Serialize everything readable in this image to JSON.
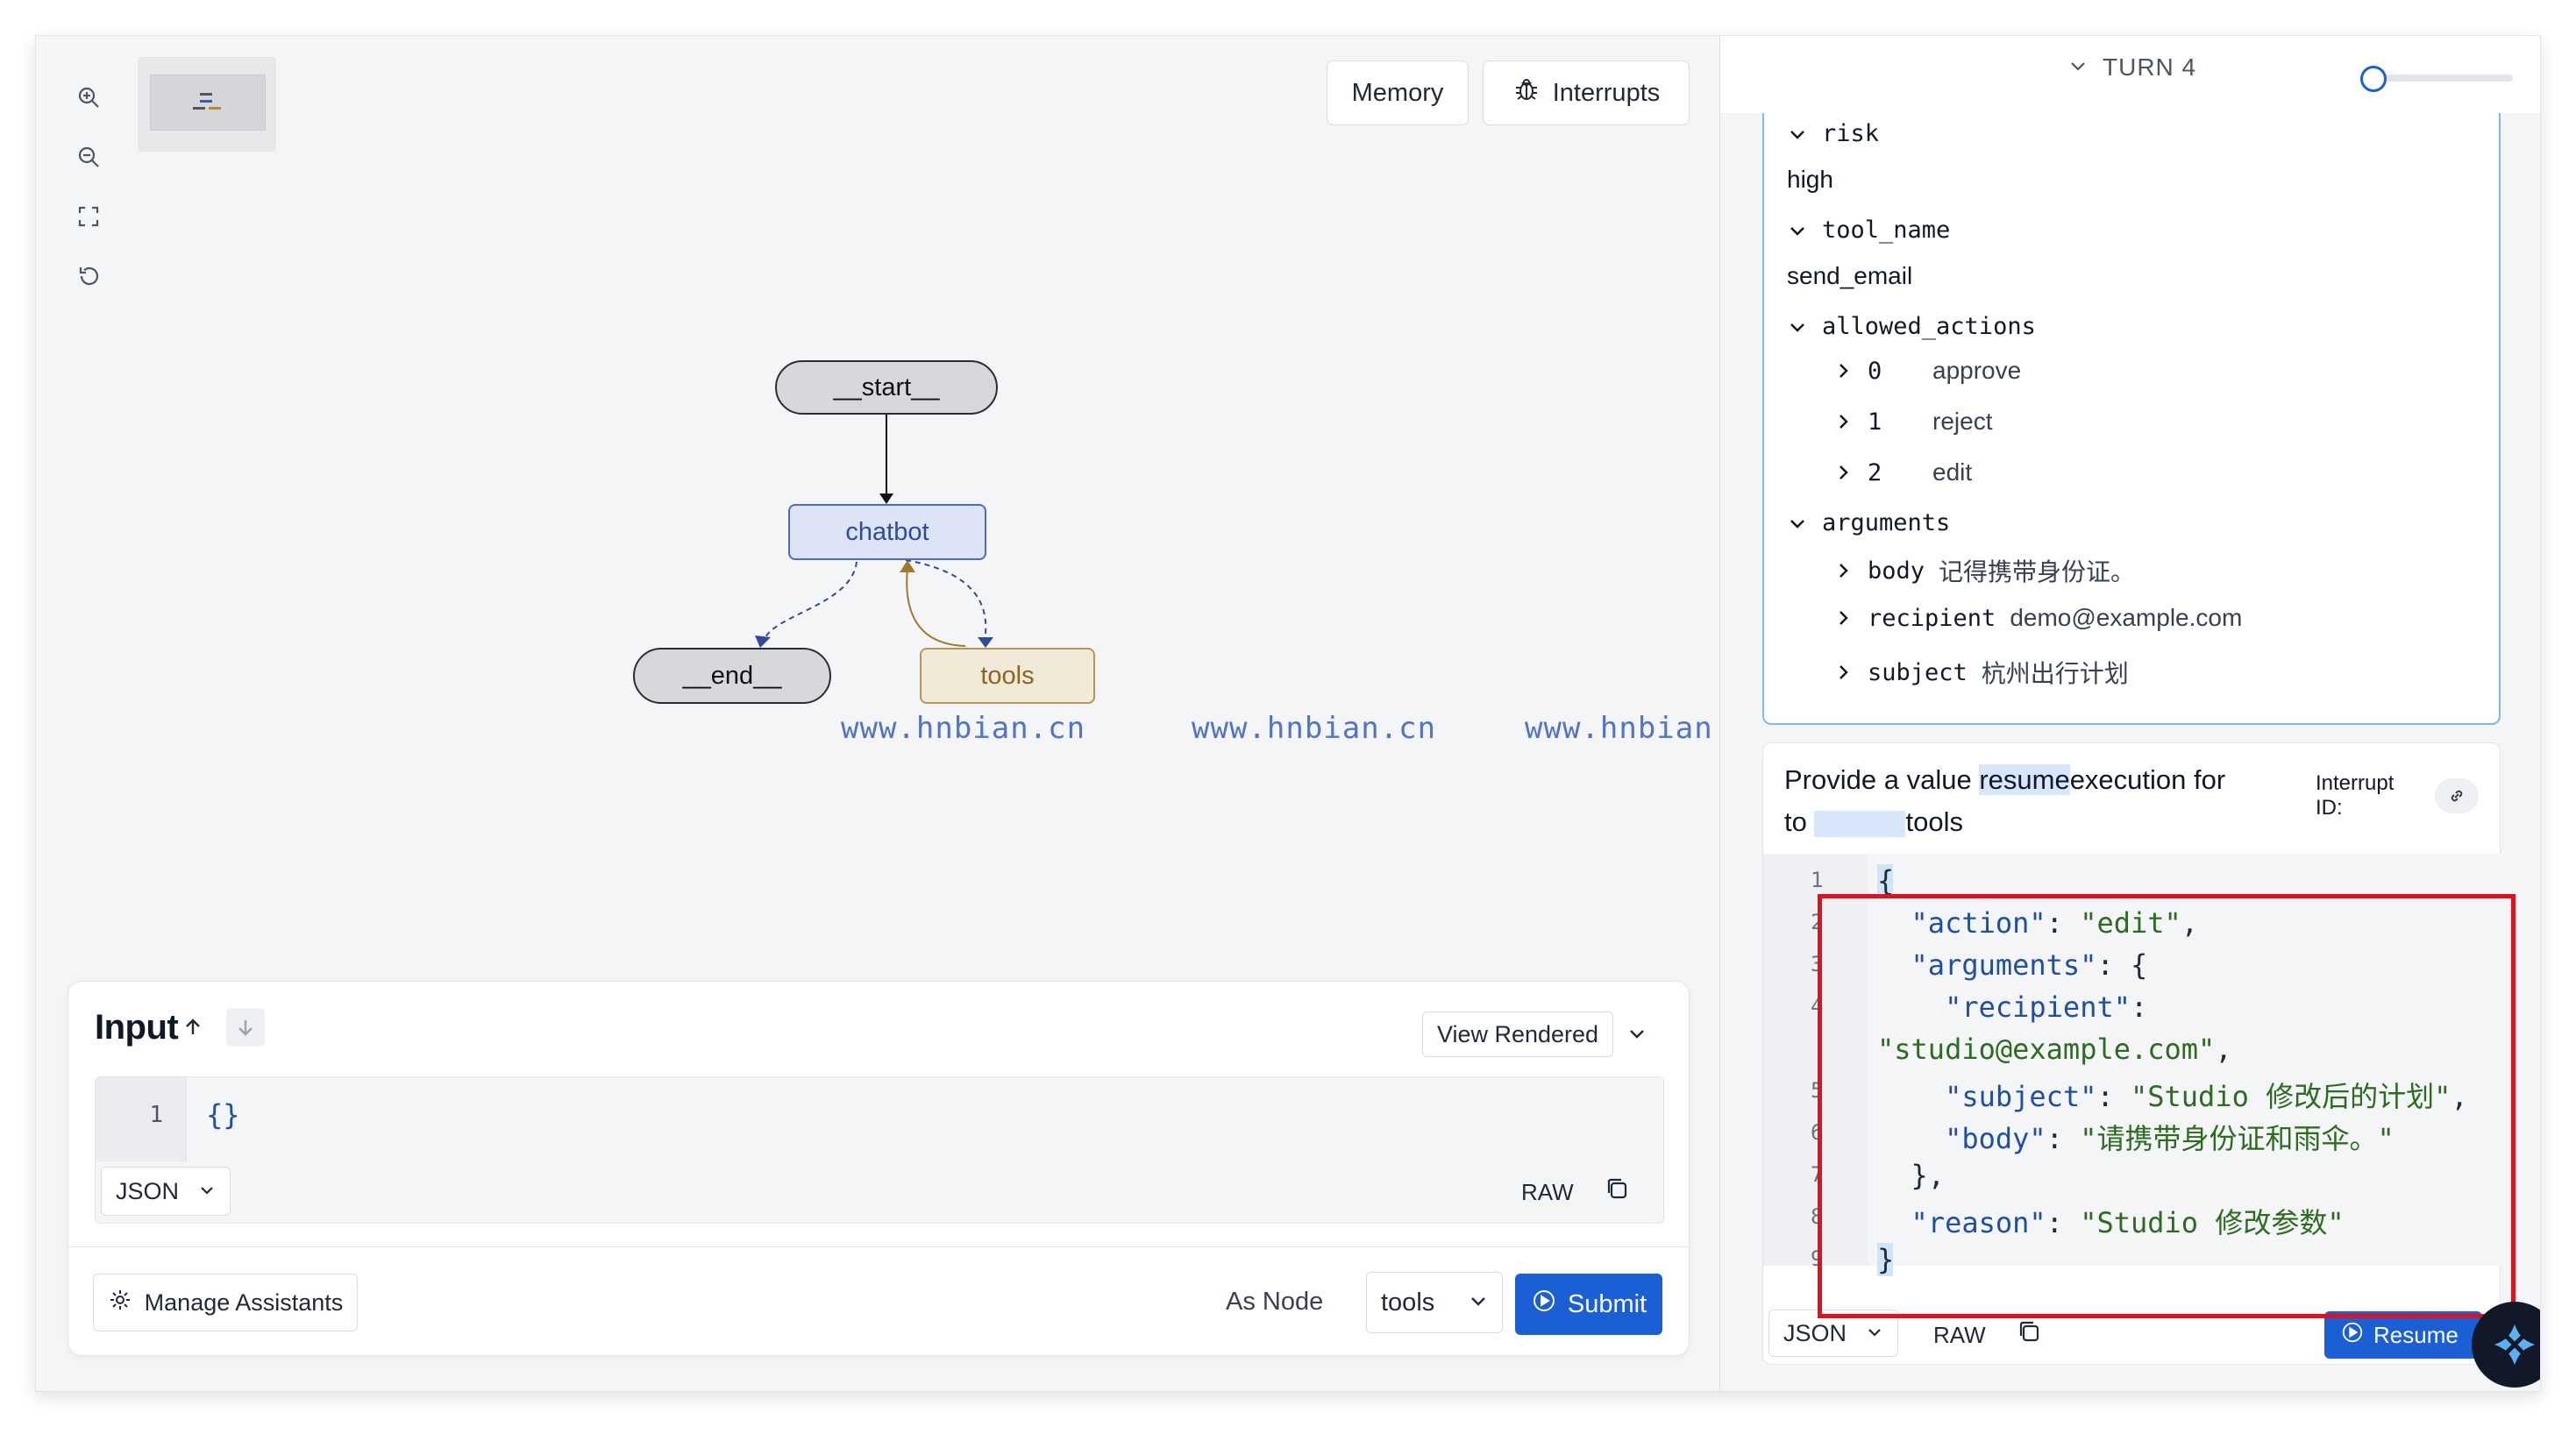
{
  "toolbar": {
    "memory_label": "Memory",
    "interrupts_label": "Interrupts"
  },
  "icons": {
    "zoom_in": "zoom-in-icon",
    "zoom_out": "zoom-out-icon",
    "fit": "fit-view-icon",
    "reset": "reset-icon",
    "bug": "bug-icon",
    "gear": "gear-icon",
    "copy": "copy-icon",
    "link": "link-icon",
    "play": "play-circle-icon"
  },
  "graph": {
    "nodes": {
      "start": "__start__",
      "chatbot": "chatbot",
      "end": "__end__",
      "tools": "tools"
    }
  },
  "watermarks": [
    "www.hnbian.cn",
    "www.hnbian.cn",
    "www.hnbian.cn"
  ],
  "input_panel": {
    "title": "Input",
    "view_mode": "View Rendered",
    "line_number": "1",
    "code": "{}",
    "format": "JSON",
    "raw_label": "RAW",
    "manage_label": "Manage Assistants",
    "as_node_label": "As Node",
    "node_value": "tools",
    "submit_label": "Submit"
  },
  "turn": {
    "label": "TURN 4",
    "slider_value": 0
  },
  "interrupt": {
    "risk_key": "risk",
    "risk_value": "high",
    "tool_name_key": "tool_name",
    "tool_name_value": "send_email",
    "allowed_actions_key": "allowed_actions",
    "allowed_actions": [
      {
        "index": "0",
        "value": "approve"
      },
      {
        "index": "1",
        "value": "reject"
      },
      {
        "index": "2",
        "value": "edit"
      }
    ],
    "arguments_key": "arguments",
    "arguments": [
      {
        "key": "body",
        "value": "记得携带身份证。"
      },
      {
        "key": "recipient",
        "value": "demo@example.com"
      },
      {
        "key": "subject",
        "value": "杭州出行计划"
      }
    ]
  },
  "resume": {
    "title_part1": "Provide a value",
    "title_part2": "to",
    "title_highlight": "resume",
    "title_part3": "execution for",
    "title_part4": "tools",
    "interrupt_id_label": "Interrupt ID:",
    "code_lines": [
      {
        "n": "1",
        "text": "{"
      },
      {
        "n": "2",
        "text": "  \"action\": \"edit\","
      },
      {
        "n": "3",
        "text": "  \"arguments\": {"
      },
      {
        "n": "4",
        "text": "    \"recipient\":"
      },
      {
        "n": "",
        "text": "\"studio@example.com\","
      },
      {
        "n": "5",
        "text": "    \"subject\": \"Studio 修改后的计划\","
      },
      {
        "n": "6",
        "text": "    \"body\": \"请携带身份证和雨伞。\""
      },
      {
        "n": "7",
        "text": "  },"
      },
      {
        "n": "8",
        "text": "  \"reason\": \"Studio 修改参数\""
      },
      {
        "n": "9",
        "text": "}"
      }
    ],
    "format": "JSON",
    "raw_label": "RAW",
    "resume_label": "Resume"
  }
}
